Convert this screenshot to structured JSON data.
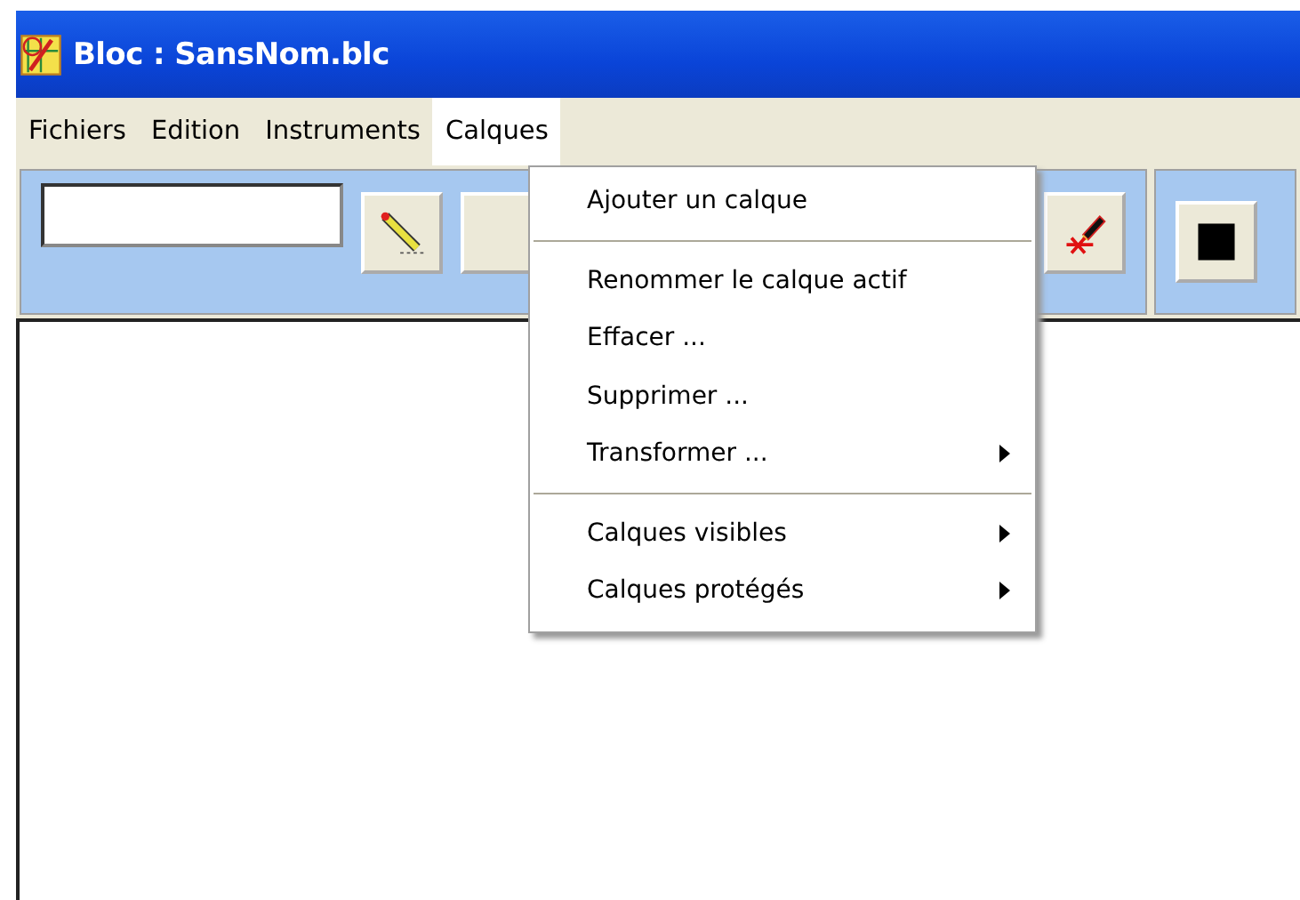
{
  "window": {
    "title": "Bloc : SansNom.blc"
  },
  "menubar": [
    {
      "label": "Fichiers",
      "selected": false
    },
    {
      "label": "Edition",
      "selected": false
    },
    {
      "label": "Instruments",
      "selected": false
    },
    {
      "label": "Calques",
      "selected": true
    }
  ],
  "menu": [
    {
      "kind": "item",
      "label": "Ajouter un calque",
      "submenu": false
    },
    {
      "kind": "separator"
    },
    {
      "kind": "item",
      "label": "Renommer le calque actif",
      "submenu": false
    },
    {
      "kind": "item",
      "label": "Effacer ...",
      "submenu": false
    },
    {
      "kind": "item",
      "label": "Supprimer ...",
      "submenu": false
    },
    {
      "kind": "item",
      "label": "Transformer ...",
      "submenu": true
    },
    {
      "kind": "separator"
    },
    {
      "kind": "item",
      "label": "Calques visibles",
      "submenu": true
    },
    {
      "kind": "item",
      "label": "Calques protégés",
      "submenu": true
    }
  ]
}
